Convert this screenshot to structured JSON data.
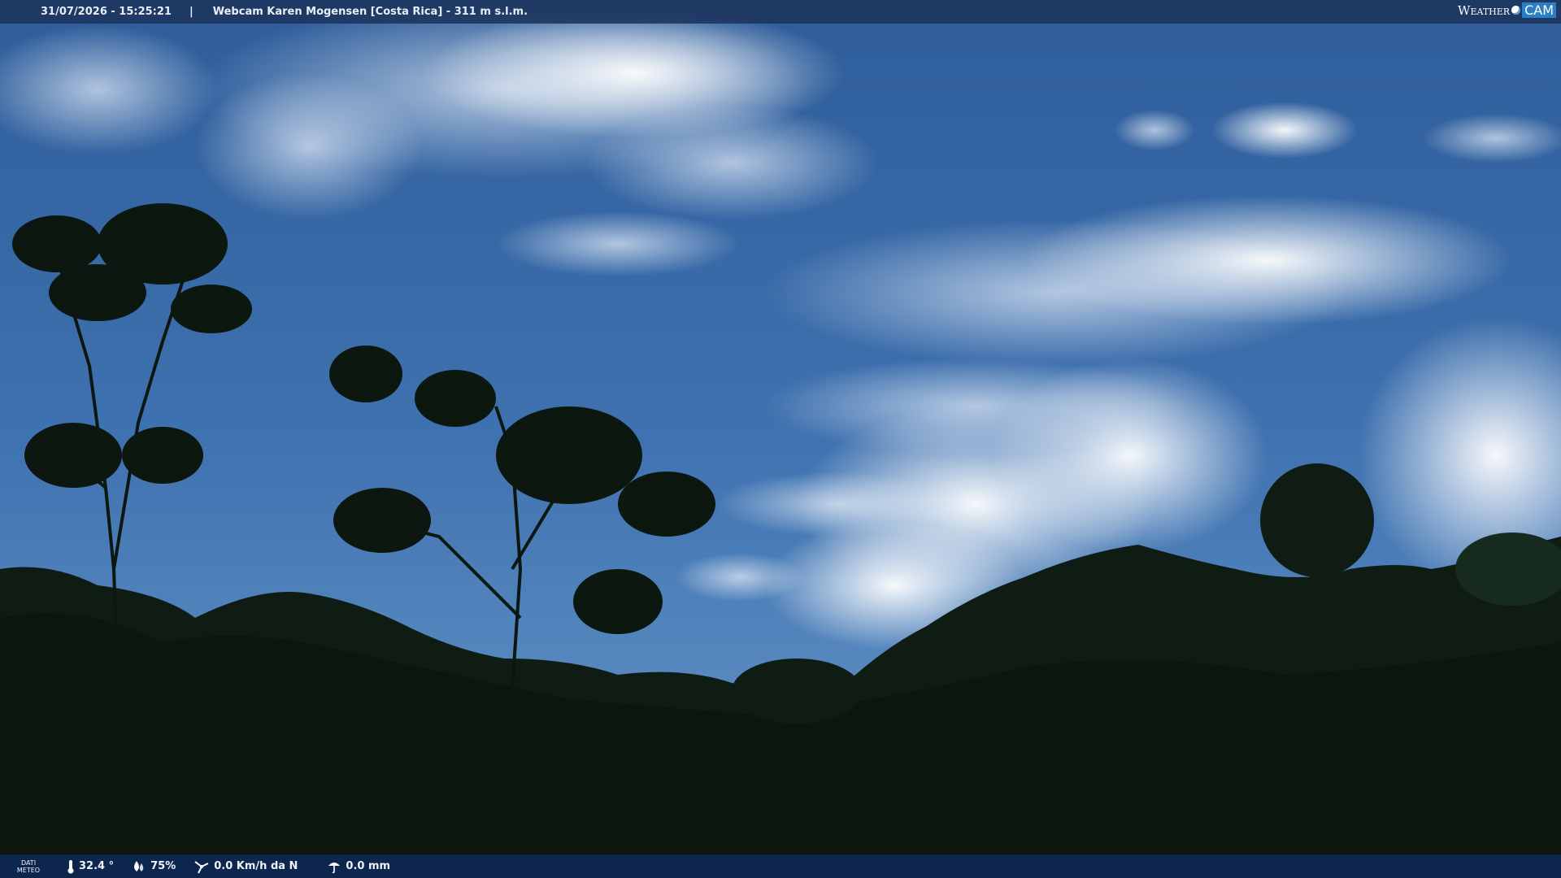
{
  "header": {
    "datetime": "31/07/2026 - 15:25:21",
    "separator": "|",
    "title": "Webcam Karen Mogensen [Costa Rica]  - 311 m s.l.m.",
    "logo_text_1": "Weather",
    "logo_text_2": "CAM"
  },
  "footer": {
    "label_line1": "DATI",
    "label_line2": "METEO",
    "temperature": "32.4 °",
    "humidity": "75%",
    "wind": "0.0 Km/h da N",
    "rain": "0.0 mm",
    "icons": [
      "thermometer-icon",
      "humidity-drop-icon",
      "wind-icon",
      "rain-gauge-icon"
    ]
  },
  "colors": {
    "sky_top": "#2f5f9c",
    "sky_bottom": "#5c90c8",
    "foliage": "#122016",
    "bar": "#1c345c"
  }
}
